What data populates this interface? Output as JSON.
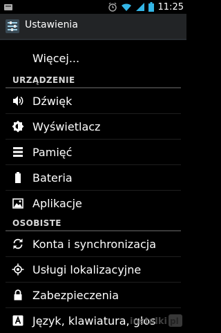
{
  "status_bar": {
    "time": "11:25"
  },
  "action_bar": {
    "title": "Ustawienia"
  },
  "list": {
    "more_label": "Więcej...",
    "sections": [
      {
        "header": "URZĄDZENIE",
        "items": [
          {
            "label": "Dźwięk",
            "icon": "speaker-icon"
          },
          {
            "label": "Wyświetlacz",
            "icon": "brightness-icon"
          },
          {
            "label": "Pamięć",
            "icon": "storage-icon"
          },
          {
            "label": "Bateria",
            "icon": "battery-icon"
          },
          {
            "label": "Aplikacje",
            "icon": "apps-icon"
          }
        ]
      },
      {
        "header": "OSOBISTE",
        "items": [
          {
            "label": "Konta i synchronizacja",
            "icon": "sync-icon"
          },
          {
            "label": "Usługi lokalizacyjne",
            "icon": "location-icon"
          },
          {
            "label": "Zabezpieczenia",
            "icon": "lock-icon"
          },
          {
            "label": "Język, klawiatura, głos",
            "icon": "language-icon"
          }
        ]
      }
    ]
  },
  "watermark": {
    "text": "instalki.pl"
  },
  "colors": {
    "background": "#000000",
    "action_bar": "#222426",
    "accent": "#33b5e5"
  }
}
